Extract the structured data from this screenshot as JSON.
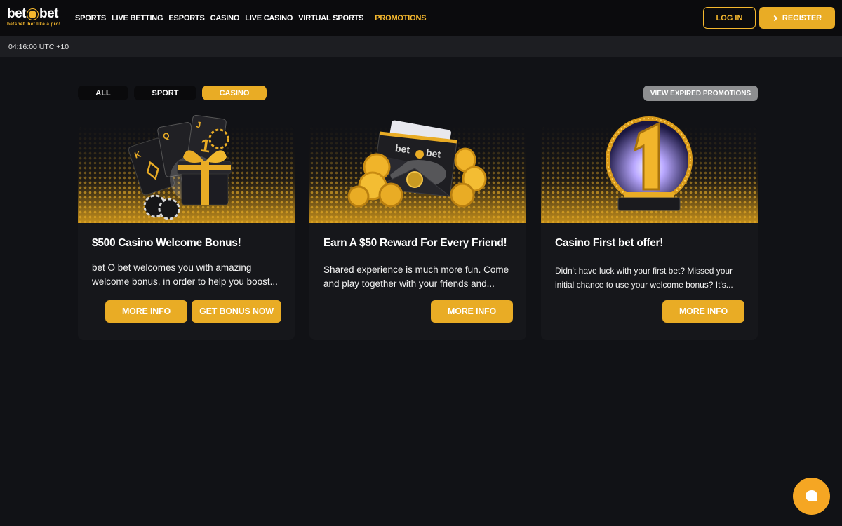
{
  "brand": {
    "logo_left": "bet",
    "logo_right": "bet",
    "tagline": "betsbet. bet like a pro!",
    "accent": "#e9ac25"
  },
  "nav": {
    "items": [
      "SPORTS",
      "LIVE BETTING",
      "ESPORTS",
      "CASINO",
      "LIVE CASINO",
      "VIRTUAL SPORTS"
    ],
    "promotions": "PROMOTIONS"
  },
  "auth": {
    "login": "LOG IN",
    "register": "REGISTER"
  },
  "clock": "04:16:00 UTC +10",
  "filters": {
    "tabs": [
      {
        "label": "ALL",
        "active": false
      },
      {
        "label": "SPORT",
        "active": false
      },
      {
        "label": "CASINO",
        "active": true
      }
    ],
    "view_expired": "VIEW EXPIRED PROMOTIONS"
  },
  "promotions": [
    {
      "title": "$500 Casino Welcome Bonus!",
      "description": "bet O bet welcomes you with amazing welcome bonus, in order to help you boost...",
      "image_icon": "gift-cards-chips-icon",
      "buttons": [
        "MORE INFO",
        "GET BONUS NOW"
      ]
    },
    {
      "title": "Earn A $50 Reward For Every Friend!",
      "description": "Shared experience is much more fun. Come and play together with your friends and...",
      "image_icon": "envelope-coins-icon",
      "envelope_logo": "bet bet",
      "buttons": [
        "MORE INFO"
      ]
    },
    {
      "title": "Casino First bet offer!",
      "description": "Didn't have luck with your first bet? Missed your initial chance to use your welcome bonus? It's...",
      "image_icon": "number-one-trophy-icon",
      "trophy_number": "1",
      "buttons": [
        "MORE INFO"
      ]
    }
  ],
  "chat": {
    "icon": "chat-bubble-icon"
  }
}
